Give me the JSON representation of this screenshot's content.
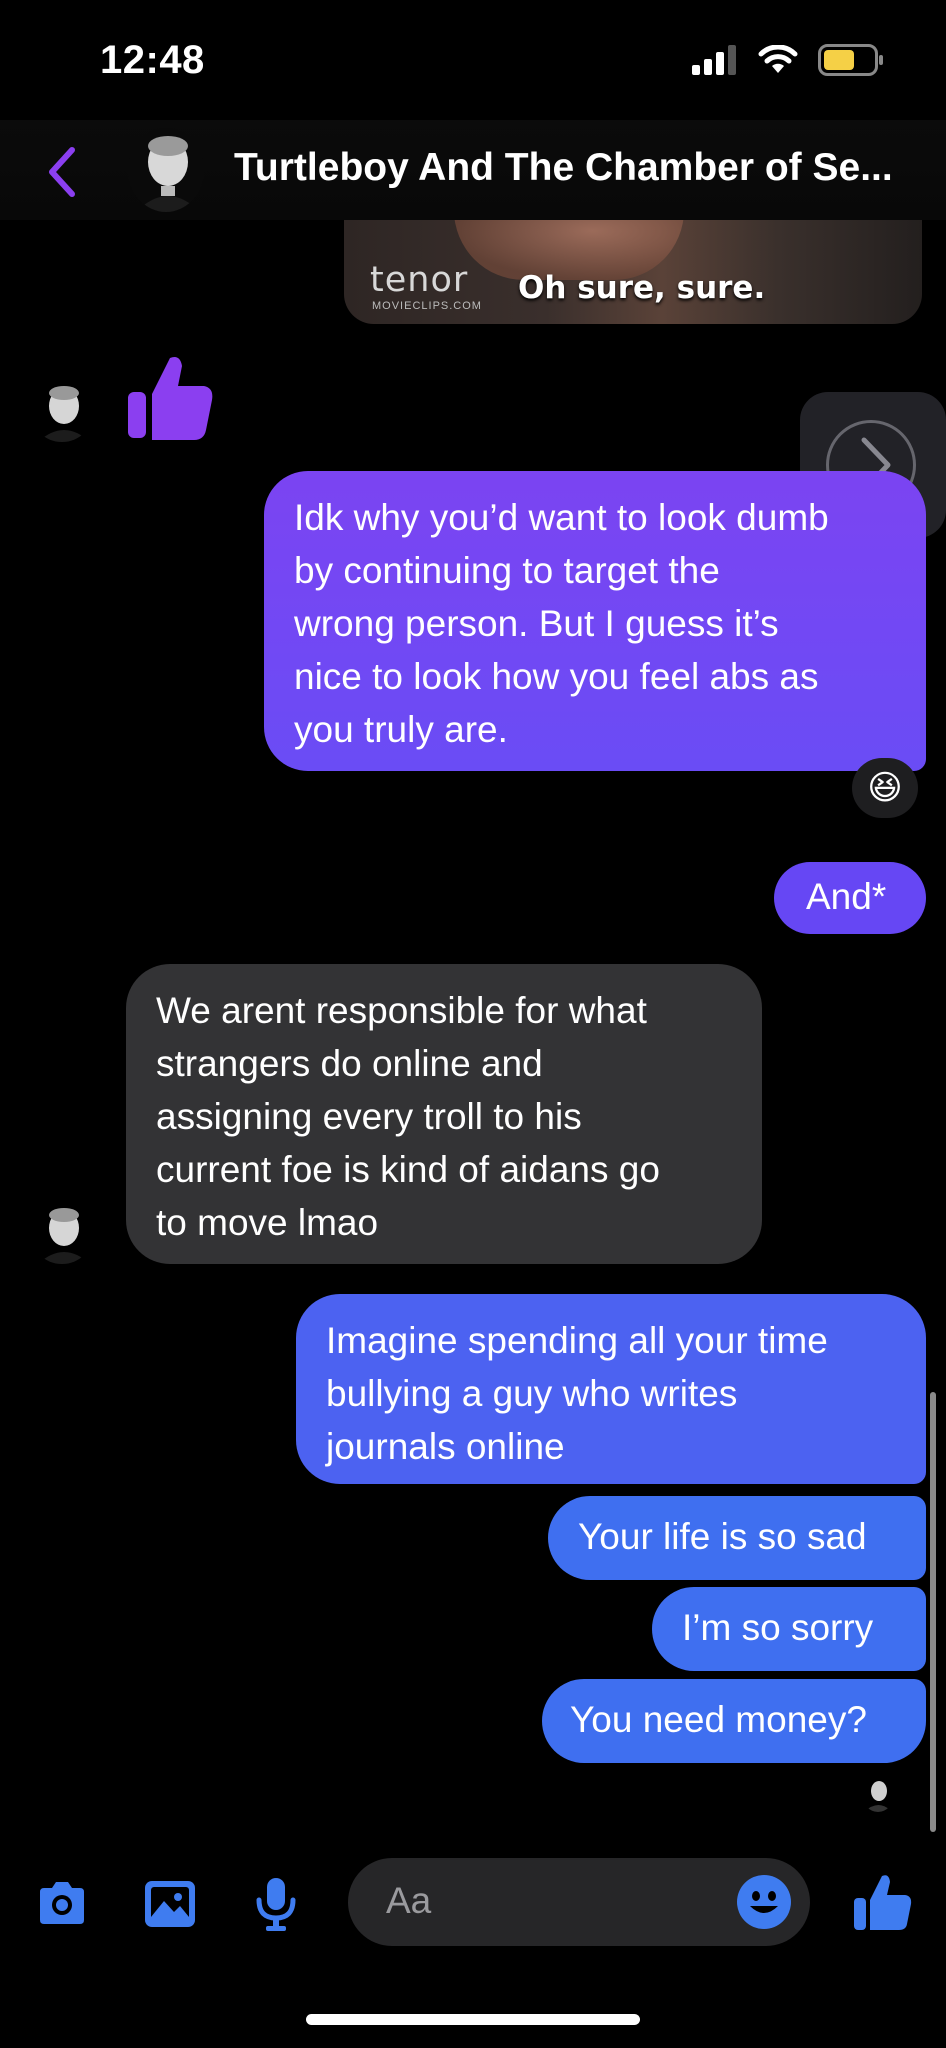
{
  "status_bar": {
    "time": "12:48"
  },
  "header": {
    "title": "Turtleboy And The Chamber of Se..."
  },
  "gif": {
    "brand": "tenor",
    "source": "MOVIECLIPS.COM",
    "caption": "Oh sure, sure."
  },
  "messages": [
    {
      "side": "received",
      "type": "like"
    },
    {
      "side": "sent",
      "text": "Idk why you’d want to look dumb by continuing to target the wrong person. But I guess it’s nice to look how you feel abs as you truly are.",
      "lines": [
        "Idk why you’d want to look dumb",
        "by continuing to target the",
        "wrong person. But I guess it’s",
        "nice to look how you feel abs as",
        "you truly are."
      ],
      "reaction": "😆"
    },
    {
      "side": "sent",
      "text": "And*"
    },
    {
      "side": "received",
      "text": "We arent responsible for what strangers do online and assigning every troll to his current foe is kind of aidans go to move lmao",
      "lines": [
        "We arent responsible for what",
        "strangers do online and",
        "assigning every troll to his",
        "current foe is kind of aidans go",
        "to move lmao"
      ]
    },
    {
      "side": "sent",
      "text": "Imagine spending all your time bullying a guy who writes journals online",
      "lines": [
        "Imagine spending all your time",
        "bullying a guy who writes",
        "journals online"
      ]
    },
    {
      "side": "sent",
      "text": "Your life is so sad"
    },
    {
      "side": "sent",
      "text": "I’m so sorry"
    },
    {
      "side": "sent",
      "text": "You need money?"
    }
  ],
  "composer": {
    "placeholder": "Aa"
  },
  "colors": {
    "accent": "#7d3ff2",
    "messenger_blue": "#3f7cf0",
    "received_bubble": "#333335"
  }
}
